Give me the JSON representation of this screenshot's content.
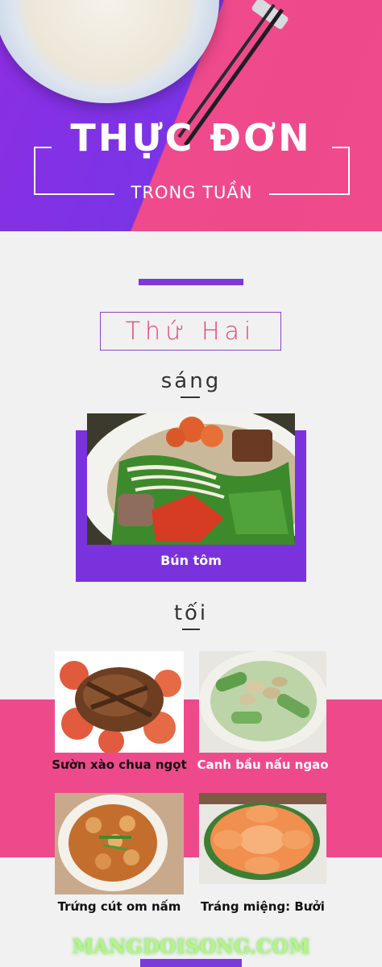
{
  "header": {
    "title": "THỰC ĐƠN",
    "subtitle": "TRONG TUẦN",
    "plate_icon": "plate-of-food",
    "chopsticks_icon": "chopsticks"
  },
  "day": {
    "name": "Thứ Hai"
  },
  "morning": {
    "label": "sáng",
    "dish": {
      "name": "Bún tôm",
      "icon": "noodle-soup-photo"
    }
  },
  "evening": {
    "label": "tối",
    "dishes": [
      {
        "name": "Sườn xào chua ngọt",
        "icon": "pork-ribs-photo"
      },
      {
        "name": "Canh bầu nấu ngao",
        "icon": "gourd-clam-soup-photo"
      },
      {
        "name": "Trứng cút om nấm",
        "icon": "quail-egg-stew-photo"
      },
      {
        "name": "Tráng miệng: Bưởi",
        "icon": "pomelo-photo"
      }
    ]
  },
  "footer": {
    "watermark": "MANGDOISONG.COM"
  },
  "colors": {
    "purple": "#7a33dc",
    "pink": "#ee4a8b",
    "background": "#f1f1f1",
    "watermark": "#b7f28a"
  }
}
